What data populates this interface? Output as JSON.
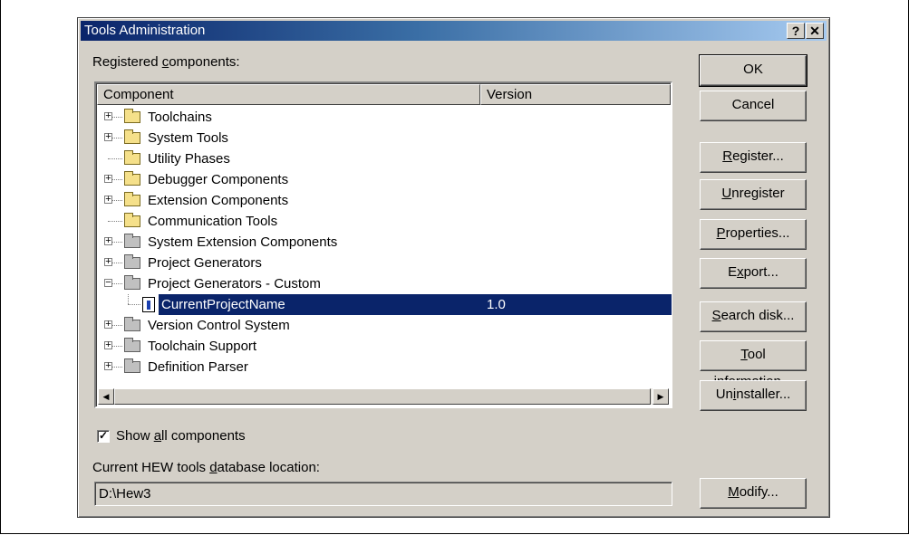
{
  "window": {
    "title": "Tools Administration",
    "help_label": "?",
    "close_label": "✕"
  },
  "registered_label": {
    "pre": "Registered ",
    "key": "c",
    "post": "omponents:"
  },
  "columns": {
    "component": "Component",
    "version": "Version"
  },
  "tree": [
    {
      "name": "Toolchains",
      "version": "",
      "expandable": true,
      "expanded": false,
      "icon": "folder-icon",
      "color": "yellow",
      "level": 0
    },
    {
      "name": "System Tools",
      "version": "",
      "expandable": true,
      "expanded": false,
      "icon": "folder-icon",
      "color": "yellow",
      "level": 0
    },
    {
      "name": "Utility Phases",
      "version": "",
      "expandable": false,
      "expanded": false,
      "icon": "folder-icon",
      "color": "yellow",
      "level": 0
    },
    {
      "name": "Debugger Components",
      "version": "",
      "expandable": true,
      "expanded": false,
      "icon": "folder-icon",
      "color": "yellow",
      "level": 0
    },
    {
      "name": "Extension Components",
      "version": "",
      "expandable": true,
      "expanded": false,
      "icon": "folder-icon",
      "color": "yellow",
      "level": 0
    },
    {
      "name": "Communication Tools",
      "version": "",
      "expandable": false,
      "expanded": false,
      "icon": "folder-icon",
      "color": "yellow",
      "level": 0
    },
    {
      "name": "System Extension Components",
      "version": "",
      "expandable": true,
      "expanded": false,
      "icon": "folder-icon",
      "color": "gray",
      "level": 0
    },
    {
      "name": "Project Generators",
      "version": "",
      "expandable": true,
      "expanded": false,
      "icon": "folder-icon",
      "color": "gray",
      "level": 0
    },
    {
      "name": "Project Generators - Custom",
      "version": "",
      "expandable": true,
      "expanded": true,
      "icon": "open-folder-icon",
      "color": "gray",
      "level": 0
    },
    {
      "name": "CurrentProjectName",
      "version": "1.0",
      "expandable": false,
      "expanded": false,
      "icon": "tool-icon",
      "color": "none",
      "level": 1,
      "selected": true
    },
    {
      "name": "Version Control System",
      "version": "",
      "expandable": true,
      "expanded": false,
      "icon": "folder-icon",
      "color": "gray",
      "level": 0
    },
    {
      "name": "Toolchain Support",
      "version": "",
      "expandable": true,
      "expanded": false,
      "icon": "folder-icon",
      "color": "gray",
      "level": 0
    },
    {
      "name": "Definition Parser",
      "version": "",
      "expandable": true,
      "expanded": false,
      "icon": "folder-icon",
      "color": "gray",
      "level": 0
    }
  ],
  "scrollbar": {
    "left": "◀",
    "right": "▶"
  },
  "show_all": {
    "checked": true,
    "check_mark": "✓",
    "pre": "Show ",
    "key": "a",
    "post": "ll components"
  },
  "db_label": {
    "pre": "Current HEW tools ",
    "key": "d",
    "post": "atabase location:"
  },
  "db_location": "D:\\Hew3",
  "buttons": {
    "ok": {
      "pre": "",
      "key": "",
      "post": "OK"
    },
    "cancel": {
      "pre": "",
      "key": "",
      "post": "Cancel"
    },
    "register": {
      "pre": "",
      "key": "R",
      "post": "egister..."
    },
    "unregister": {
      "pre": "",
      "key": "U",
      "post": "nregister"
    },
    "properties": {
      "pre": "",
      "key": "P",
      "post": "roperties..."
    },
    "export": {
      "pre": "E",
      "key": "x",
      "post": "port..."
    },
    "search_disk": {
      "pre": "",
      "key": "S",
      "post": "earch disk..."
    },
    "tool_information": {
      "pre": "",
      "key": "T",
      "post": "ool information..."
    },
    "uninstaller": {
      "pre": "Un",
      "key": "i",
      "post": "nstaller..."
    },
    "modify": {
      "pre": "",
      "key": "M",
      "post": "odify..."
    }
  }
}
